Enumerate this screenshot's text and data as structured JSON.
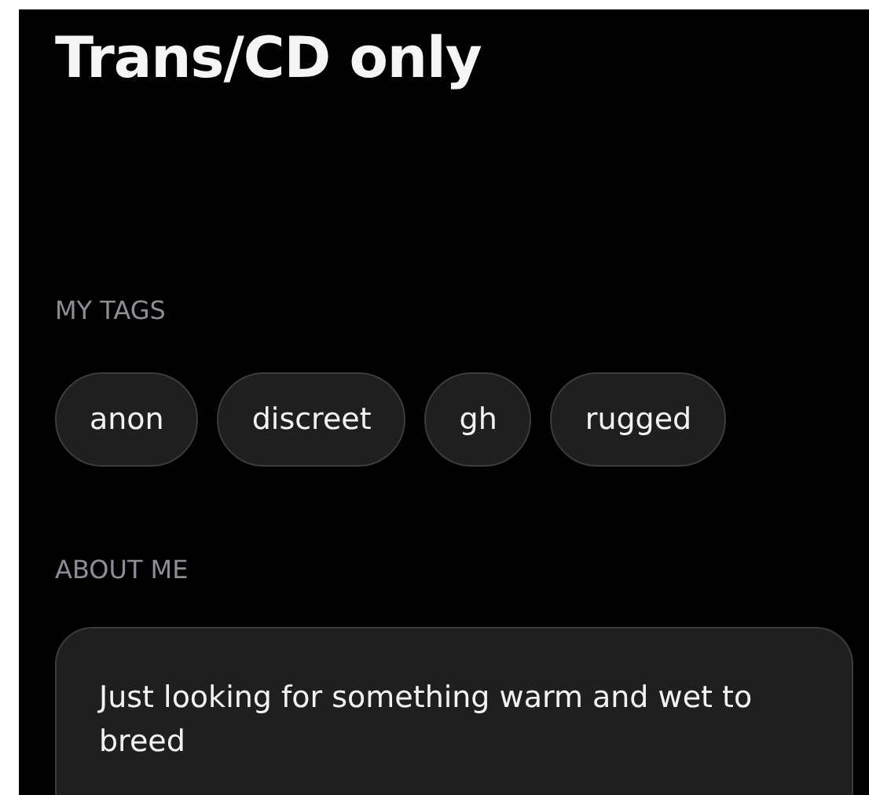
{
  "title": "Trans/CD only",
  "tags_section": {
    "label": "MY TAGS",
    "tags": [
      "anon",
      "discreet",
      "gh",
      "rugged"
    ]
  },
  "about_section": {
    "label": "ABOUT ME",
    "text": "Just looking for something warm and wet to breed"
  }
}
